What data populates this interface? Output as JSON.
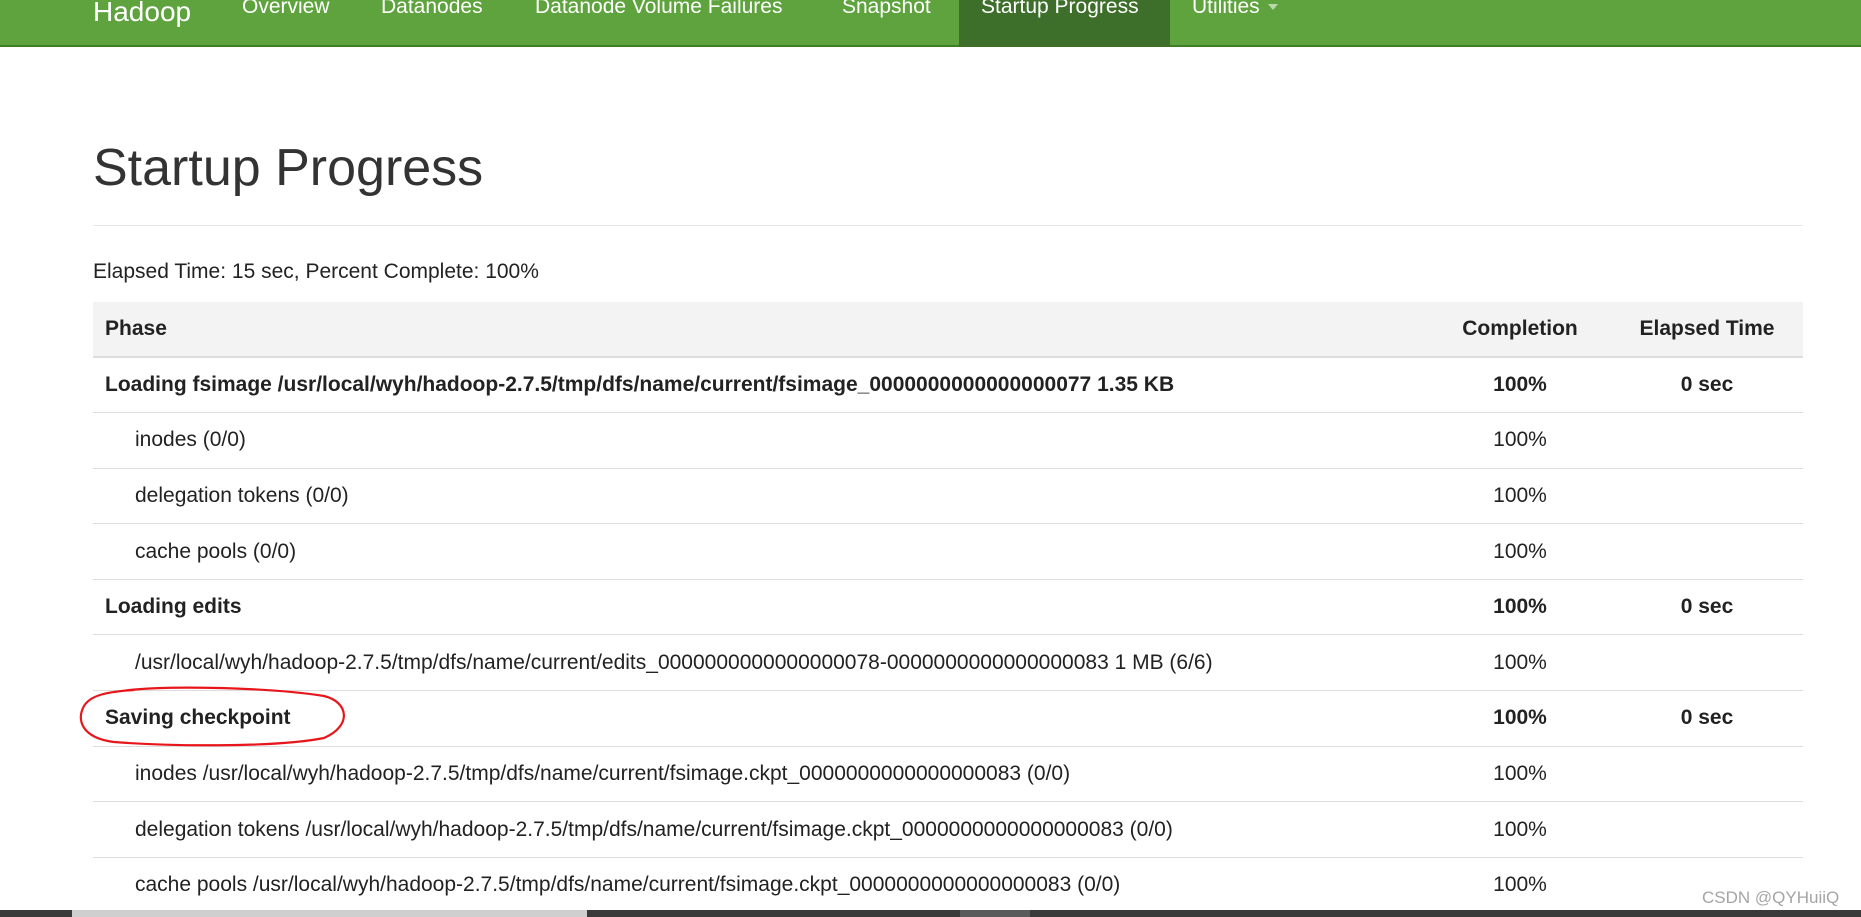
{
  "navbar": {
    "brand": "Hadoop",
    "items": [
      {
        "label": "Overview"
      },
      {
        "label": "Datanodes"
      },
      {
        "label": "Datanode Volume Failures"
      },
      {
        "label": "Snapshot"
      },
      {
        "label": "Startup Progress"
      },
      {
        "label": "Utilities"
      }
    ],
    "active_item": "Startup Progress",
    "colors": {
      "bar": "#5fa33e",
      "active": "#3d6f2a"
    }
  },
  "page": {
    "title": "Startup Progress",
    "summary": "Elapsed Time: 15 sec, Percent Complete: 100%"
  },
  "table": {
    "headers": {
      "phase": "Phase",
      "completion": "Completion",
      "elapsed": "Elapsed Time"
    },
    "rows": [
      {
        "kind": "phase",
        "phase": "Loading fsimage /usr/local/wyh/hadoop-2.7.5/tmp/dfs/name/current/fsimage_0000000000000000077 1.35 KB",
        "completion": "100%",
        "elapsed": "0 sec"
      },
      {
        "kind": "step",
        "phase": "inodes (0/0)",
        "completion": "100%",
        "elapsed": ""
      },
      {
        "kind": "step",
        "phase": "delegation tokens (0/0)",
        "completion": "100%",
        "elapsed": ""
      },
      {
        "kind": "step",
        "phase": "cache pools (0/0)",
        "completion": "100%",
        "elapsed": ""
      },
      {
        "kind": "phase",
        "phase": "Loading edits",
        "completion": "100%",
        "elapsed": "0 sec"
      },
      {
        "kind": "step",
        "phase": "/usr/local/wyh/hadoop-2.7.5/tmp/dfs/name/current/edits_0000000000000000078-0000000000000000083 1 MB (6/6)",
        "completion": "100%",
        "elapsed": ""
      },
      {
        "kind": "phase",
        "phase": "Saving checkpoint",
        "completion": "100%",
        "elapsed": "0 sec"
      },
      {
        "kind": "step",
        "phase": "inodes /usr/local/wyh/hadoop-2.7.5/tmp/dfs/name/current/fsimage.ckpt_0000000000000000083 (0/0)",
        "completion": "100%",
        "elapsed": ""
      },
      {
        "kind": "step",
        "phase": "delegation tokens /usr/local/wyh/hadoop-2.7.5/tmp/dfs/name/current/fsimage.ckpt_0000000000000000083 (0/0)",
        "completion": "100%",
        "elapsed": ""
      },
      {
        "kind": "step",
        "phase": "cache pools /usr/local/wyh/hadoop-2.7.5/tmp/dfs/name/current/fsimage.ckpt_0000000000000000083 (0/0)",
        "completion": "100%",
        "elapsed": ""
      }
    ]
  },
  "annotation": {
    "highlight_color": "#e8161b"
  },
  "watermark": "CSDN @QYHuiiQ"
}
